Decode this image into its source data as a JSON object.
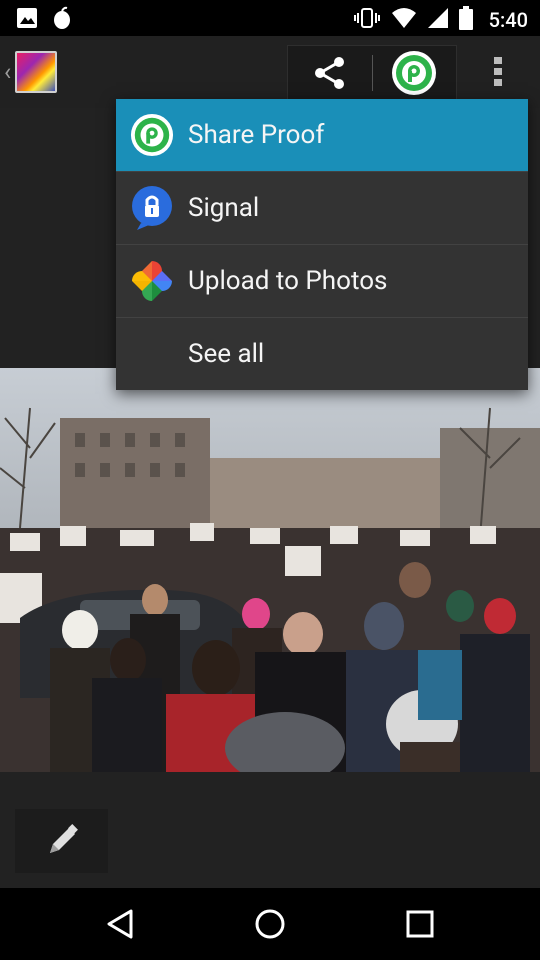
{
  "status_bar": {
    "time": "5:40",
    "left_icons": [
      "image-icon",
      "fruit-icon"
    ],
    "right_icons": [
      "vibrate-icon",
      "wifi-icon",
      "signal-icon",
      "battery-icon"
    ]
  },
  "action_bar": {
    "back_glyph": "‹",
    "app_icon": "gallery-icon",
    "share_icon": "share-icon",
    "proof_icon": "proof-app-icon",
    "overflow_icon": "more-vert-icon"
  },
  "share_menu": {
    "items": [
      {
        "label": "Share Proof",
        "icon": "proof-app-icon",
        "selected": true
      },
      {
        "label": "Signal",
        "icon": "signal-app-icon",
        "selected": false
      },
      {
        "label": "Upload to Photos",
        "icon": "google-photos-icon",
        "selected": false
      },
      {
        "label": "See all",
        "icon": "",
        "selected": false
      }
    ]
  },
  "edit_button": {
    "icon": "pencil-icon"
  },
  "nav_bar": {
    "buttons": [
      "back-icon",
      "home-icon",
      "recents-icon"
    ]
  },
  "colors": {
    "menu_selected": "#1a8fb8",
    "menu_bg": "#333333",
    "proof_green": "#2db34a",
    "signal_blue": "#2a6cdd"
  }
}
